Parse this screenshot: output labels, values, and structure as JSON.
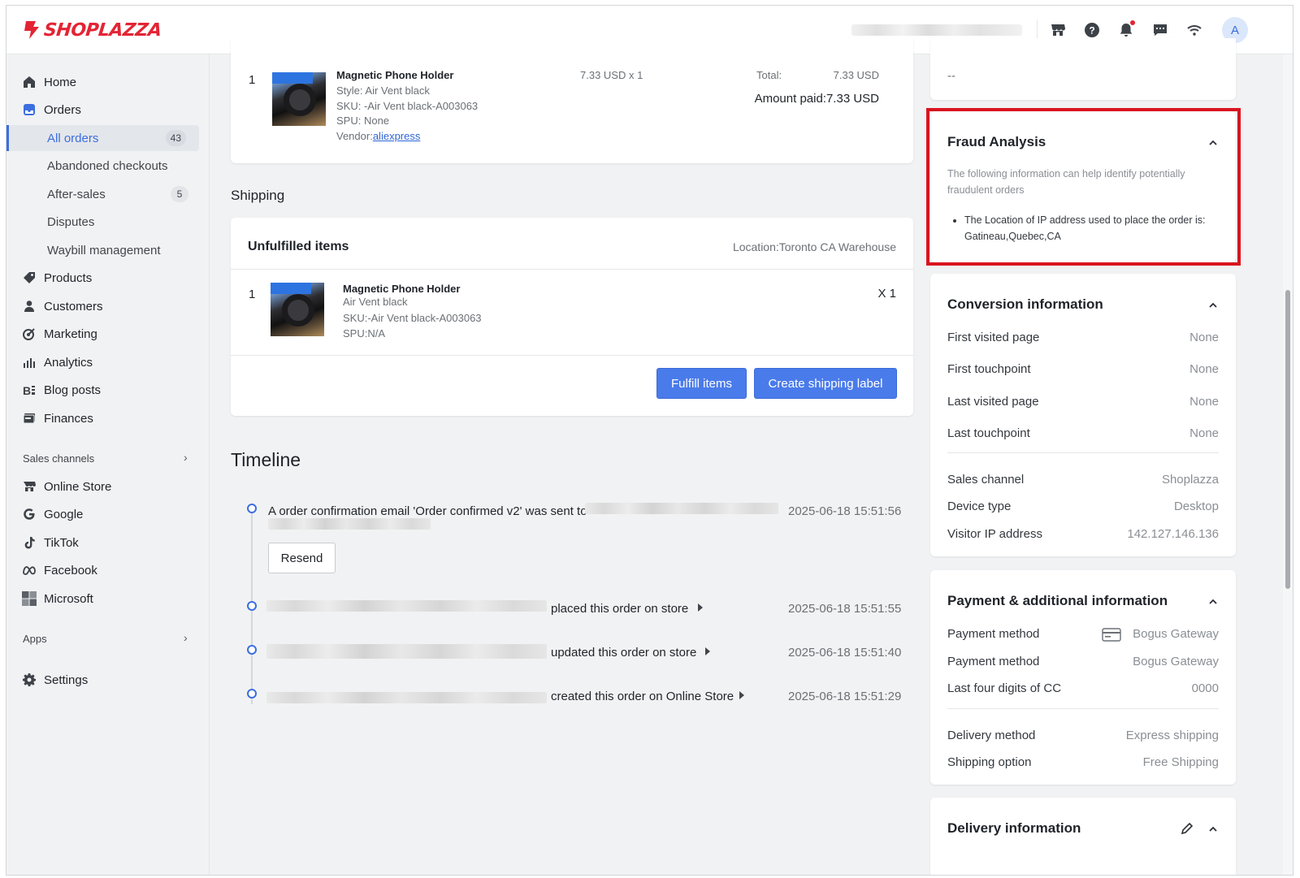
{
  "topbar": {
    "brand": "SHOPLAZZA",
    "avatar_initial": "A",
    "icons": [
      "store-icon",
      "help-icon",
      "bell-icon",
      "chat-icon",
      "wifi-icon"
    ]
  },
  "sidebar": {
    "items": [
      {
        "label": "Home",
        "icon": "home-icon"
      },
      {
        "label": "Orders",
        "icon": "orders-icon"
      },
      {
        "label": "Products",
        "icon": "tag-icon"
      },
      {
        "label": "Customers",
        "icon": "person-icon"
      },
      {
        "label": "Marketing",
        "icon": "marketing-icon"
      },
      {
        "label": "Analytics",
        "icon": "bar-chart-icon"
      },
      {
        "label": "Blog posts",
        "icon": "blog-icon"
      },
      {
        "label": "Finances",
        "icon": "finance-icon"
      }
    ],
    "orders_sub": [
      {
        "label": "All orders",
        "badge": "43"
      },
      {
        "label": "Abandoned checkouts"
      },
      {
        "label": "After-sales",
        "badge": "5"
      },
      {
        "label": "Disputes"
      },
      {
        "label": "Waybill management"
      }
    ],
    "sales_channels_label": "Sales channels",
    "channels": [
      {
        "label": "Online Store",
        "icon": "store-icon"
      },
      {
        "label": "Google",
        "icon": "google-icon"
      },
      {
        "label": "TikTok",
        "icon": "tiktok-icon"
      },
      {
        "label": "Facebook",
        "icon": "meta-icon"
      },
      {
        "label": "Microsoft",
        "icon": "microsoft-icon"
      }
    ],
    "apps_label": "Apps",
    "settings_label": "Settings"
  },
  "order_item": {
    "index": "1",
    "name": "Magnetic Phone Holder",
    "style": "Style: Air Vent black",
    "sku": "SKU: -Air Vent black-A003063",
    "spu": "SPU: None",
    "vendor_prefix": "Vendor:",
    "vendor_link": "aliexpress",
    "price_qty": "7.33 USD x 1",
    "total_label": "Total:",
    "total_value": "7.33 USD",
    "amount_paid": "Amount paid:7.33 USD"
  },
  "shipping": {
    "heading": "Shipping",
    "card_title": "Unfulfilled items",
    "location": "Location:Toronto CA Warehouse",
    "item_index": "1",
    "item_name": "Magnetic Phone Holder",
    "item_variant": "Air Vent black",
    "item_sku": "SKU:-Air Vent black-A003063",
    "item_spu": "SPU:N/A",
    "item_qty": "X 1",
    "fulfill_btn": "Fulfill items",
    "label_btn": "Create shipping label"
  },
  "timeline": {
    "heading": "Timeline",
    "events": [
      {
        "text": "A order confirmation email 'Order confirmed v2' was sent to",
        "time": "2025-06-18 15:51:56",
        "button": "Resend"
      },
      {
        "text": "placed this order on store",
        "time": "2025-06-18 15:51:55"
      },
      {
        "text": "updated this order on store",
        "time": "2025-06-18 15:51:40"
      },
      {
        "text": "created this order on Online Store",
        "time": "2025-06-18 15:51:29"
      }
    ]
  },
  "right": {
    "top_value": "--",
    "fraud": {
      "title": "Fraud Analysis",
      "desc": "The following information can help identify potentially fraudulent orders",
      "bullet": "The Location of IP address used to place the order is: Gatineau,Quebec,CA"
    },
    "conversion": {
      "title": "Conversion information",
      "rows": [
        {
          "label": "First visited page",
          "value": "None"
        },
        {
          "label": "First touchpoint",
          "value": "None"
        },
        {
          "label": "Last visited page",
          "value": "None"
        },
        {
          "label": "Last touchpoint",
          "value": "None"
        }
      ],
      "rows2": [
        {
          "label": "Sales channel",
          "value": "Shoplazza"
        },
        {
          "label": "Device type",
          "value": "Desktop"
        },
        {
          "label": "Visitor IP address",
          "value": "142.127.146.136"
        }
      ]
    },
    "payment": {
      "title": "Payment & additional information",
      "rows": [
        {
          "label": "Payment method",
          "value": "Bogus Gateway"
        },
        {
          "label": "Payment method",
          "value": "Bogus Gateway"
        },
        {
          "label": "Last four digits of CC",
          "value": "0000"
        }
      ],
      "rows2": [
        {
          "label": "Delivery method",
          "value": "Express shipping"
        },
        {
          "label": "Shipping option",
          "value": "Free Shipping"
        }
      ]
    },
    "delivery": {
      "title": "Delivery information"
    }
  },
  "colors": {
    "accent": "#3c6ee0",
    "brand": "#e32434",
    "highlight": "#d9141f"
  }
}
